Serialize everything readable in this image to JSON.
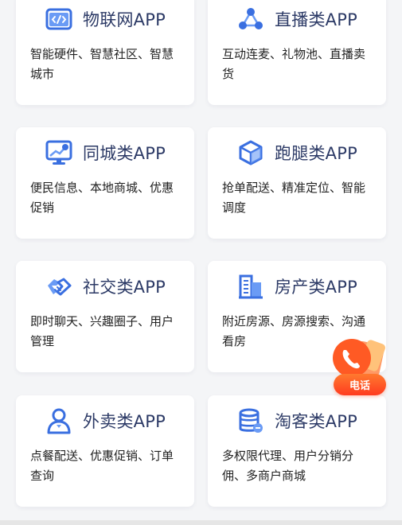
{
  "cards": [
    {
      "title": "物联网APP",
      "desc": "智能硬件、智慧社区、智慧城市",
      "icon": "code-window-icon"
    },
    {
      "title": "直播类APP",
      "desc": "互动连麦、礼物池、直播卖货",
      "icon": "network-nodes-icon"
    },
    {
      "title": "同城类APP",
      "desc": "便民信息、本地商城、优惠促销",
      "icon": "monitor-chart-icon"
    },
    {
      "title": "跑腿类APP",
      "desc": "抢单配送、精准定位、智能调度",
      "icon": "box-cube-icon"
    },
    {
      "title": "社交类APP",
      "desc": "即时聊天、兴趣圈子、用户管理",
      "icon": "handshake-icon"
    },
    {
      "title": "房产类APP",
      "desc": "附近房源、房源搜索、沟通看房",
      "icon": "building-icon"
    },
    {
      "title": "外卖类APP",
      "desc": "点餐配送、优惠促销、订单查询",
      "icon": "user-icon"
    },
    {
      "title": "淘客类APP",
      "desc": "多权限代理、用户分销分佣、多商户商城",
      "icon": "database-icon"
    }
  ],
  "float": {
    "label": "电话",
    "icon": "phone-icon"
  },
  "colors": {
    "icon_blue": "#3a6fe0",
    "title": "#2c3a66",
    "phone_orange": "#ff5a24"
  }
}
